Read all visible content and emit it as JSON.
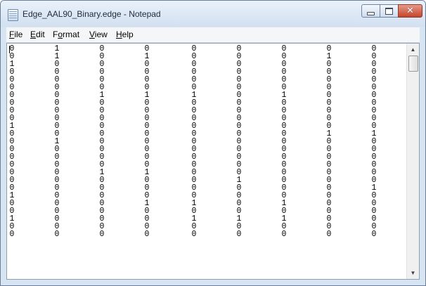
{
  "window": {
    "title": "Edge_AAL90_Binary.edge - Notepad",
    "icons": {
      "app": "notepad-icon",
      "minimize": "minimize-icon",
      "maximize": "maximize-icon",
      "close": "close-icon"
    },
    "close_glyph": "✕"
  },
  "menu": [
    {
      "label": "File",
      "mnemonic": "F",
      "rest": "ile"
    },
    {
      "label": "Edit",
      "mnemonic": "E",
      "rest": "dit"
    },
    {
      "label": "Format",
      "mnemonic": "o",
      "rest_before": "F",
      "rest": "rmat"
    },
    {
      "label": "View",
      "mnemonic": "V",
      "rest": "iew"
    },
    {
      "label": "Help",
      "mnemonic": "H",
      "rest": "elp"
    }
  ],
  "editor": {
    "rows": [
      [
        "0",
        "1",
        "0",
        "0",
        "0",
        "0",
        "0",
        "0",
        "0"
      ],
      [
        "0",
        "1",
        "0",
        "1",
        "0",
        "0",
        "0",
        "1",
        "0"
      ],
      [
        "1",
        "0",
        "0",
        "0",
        "0",
        "0",
        "0",
        "0",
        "0"
      ],
      [
        "0",
        "0",
        "0",
        "0",
        "0",
        "0",
        "0",
        "0",
        "0"
      ],
      [
        "0",
        "0",
        "0",
        "0",
        "0",
        "0",
        "0",
        "0",
        "0"
      ],
      [
        "0",
        "0",
        "0",
        "0",
        "0",
        "0",
        "0",
        "0",
        "0"
      ],
      [
        "0",
        "0",
        "1",
        "1",
        "1",
        "0",
        "1",
        "0",
        "0"
      ],
      [
        "0",
        "0",
        "0",
        "0",
        "0",
        "0",
        "0",
        "0",
        "0"
      ],
      [
        "0",
        "0",
        "0",
        "0",
        "0",
        "0",
        "0",
        "0",
        "0"
      ],
      [
        "0",
        "0",
        "0",
        "0",
        "0",
        "0",
        "0",
        "0",
        "0"
      ],
      [
        "1",
        "0",
        "0",
        "0",
        "0",
        "0",
        "0",
        "0",
        "0"
      ],
      [
        "0",
        "0",
        "0",
        "0",
        "0",
        "0",
        "0",
        "1",
        "1"
      ],
      [
        "0",
        "1",
        "0",
        "0",
        "0",
        "0",
        "0",
        "0",
        "0"
      ],
      [
        "0",
        "0",
        "0",
        "0",
        "0",
        "0",
        "0",
        "0",
        "0"
      ],
      [
        "0",
        "0",
        "0",
        "0",
        "0",
        "0",
        "0",
        "0",
        "0"
      ],
      [
        "0",
        "0",
        "0",
        "0",
        "0",
        "0",
        "0",
        "0",
        "0"
      ],
      [
        "0",
        "0",
        "1",
        "1",
        "0",
        "0",
        "0",
        "0",
        "0"
      ],
      [
        "0",
        "0",
        "0",
        "0",
        "0",
        "1",
        "0",
        "0",
        "0"
      ],
      [
        "0",
        "0",
        "0",
        "0",
        "0",
        "0",
        "0",
        "0",
        "1"
      ],
      [
        "1",
        "0",
        "0",
        "0",
        "0",
        "0",
        "0",
        "0",
        "0"
      ],
      [
        "0",
        "0",
        "0",
        "1",
        "1",
        "0",
        "1",
        "0",
        "0"
      ],
      [
        "0",
        "0",
        "0",
        "0",
        "0",
        "0",
        "0",
        "0",
        "0"
      ],
      [
        "1",
        "0",
        "0",
        "0",
        "1",
        "1",
        "1",
        "0",
        "0"
      ],
      [
        "0",
        "0",
        "0",
        "0",
        "0",
        "0",
        "0",
        "0",
        "0"
      ],
      [
        "0",
        "0",
        "0",
        "0",
        "0",
        "0",
        "0",
        "0",
        "0"
      ]
    ]
  },
  "scrollbar": {
    "up_glyph": "▲",
    "down_glyph": "▼",
    "position": 0
  }
}
